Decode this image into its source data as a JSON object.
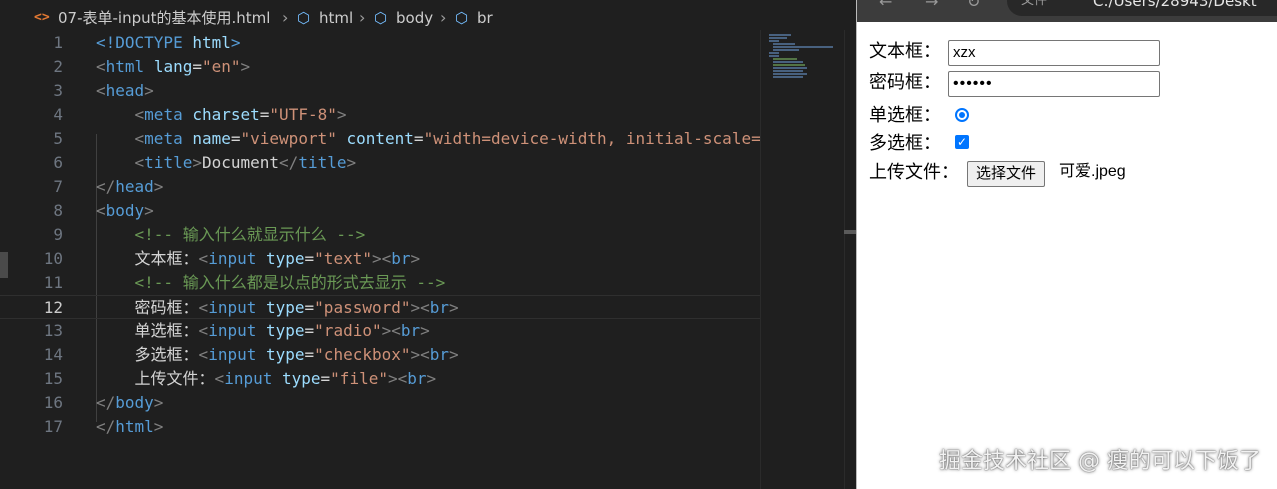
{
  "editor": {
    "breadcrumb": {
      "file": "07-表单-input的基本使用.html",
      "items": [
        "html",
        "body",
        "br"
      ]
    },
    "code_lines": [
      {
        "num": "1",
        "segments": [
          {
            "t": "<!DOCTYPE ",
            "c": "tag"
          },
          {
            "t": "html",
            "c": "attr"
          },
          {
            "t": ">",
            "c": "tag"
          }
        ]
      },
      {
        "num": "2",
        "segments": [
          {
            "t": "<",
            "c": "punct"
          },
          {
            "t": "html",
            "c": "tag"
          },
          {
            "t": " ",
            "c": "txt"
          },
          {
            "t": "lang",
            "c": "attr"
          },
          {
            "t": "=",
            "c": "txt"
          },
          {
            "t": "\"en\"",
            "c": "str"
          },
          {
            "t": ">",
            "c": "punct"
          }
        ]
      },
      {
        "num": "3",
        "segments": [
          {
            "t": "<",
            "c": "punct"
          },
          {
            "t": "head",
            "c": "tag"
          },
          {
            "t": ">",
            "c": "punct"
          }
        ]
      },
      {
        "num": "4",
        "segments": [
          {
            "t": "    ",
            "c": "txt"
          },
          {
            "t": "<",
            "c": "punct"
          },
          {
            "t": "meta",
            "c": "tag"
          },
          {
            "t": " ",
            "c": "txt"
          },
          {
            "t": "charset",
            "c": "attr"
          },
          {
            "t": "=",
            "c": "txt"
          },
          {
            "t": "\"UTF-8\"",
            "c": "str"
          },
          {
            "t": ">",
            "c": "punct"
          }
        ]
      },
      {
        "num": "5",
        "segments": [
          {
            "t": "    ",
            "c": "txt"
          },
          {
            "t": "<",
            "c": "punct"
          },
          {
            "t": "meta",
            "c": "tag"
          },
          {
            "t": " ",
            "c": "txt"
          },
          {
            "t": "name",
            "c": "attr"
          },
          {
            "t": "=",
            "c": "txt"
          },
          {
            "t": "\"viewport\"",
            "c": "str"
          },
          {
            "t": " ",
            "c": "txt"
          },
          {
            "t": "content",
            "c": "attr"
          },
          {
            "t": "=",
            "c": "txt"
          },
          {
            "t": "\"width=device-width, initial-scale=",
            "c": "str"
          }
        ]
      },
      {
        "num": "6",
        "segments": [
          {
            "t": "    ",
            "c": "txt"
          },
          {
            "t": "<",
            "c": "punct"
          },
          {
            "t": "title",
            "c": "tag"
          },
          {
            "t": ">",
            "c": "punct"
          },
          {
            "t": "Document",
            "c": "txt"
          },
          {
            "t": "</",
            "c": "punct"
          },
          {
            "t": "title",
            "c": "tag"
          },
          {
            "t": ">",
            "c": "punct"
          }
        ]
      },
      {
        "num": "7",
        "segments": [
          {
            "t": "</",
            "c": "punct"
          },
          {
            "t": "head",
            "c": "tag"
          },
          {
            "t": ">",
            "c": "punct"
          }
        ]
      },
      {
        "num": "8",
        "segments": [
          {
            "t": "<",
            "c": "punct"
          },
          {
            "t": "body",
            "c": "tag"
          },
          {
            "t": ">",
            "c": "punct"
          }
        ]
      },
      {
        "num": "9",
        "segments": [
          {
            "t": "    ",
            "c": "txt"
          },
          {
            "t": "<!-- 输入什么就显示什么 -->",
            "c": "cmt"
          }
        ]
      },
      {
        "num": "10",
        "segments": [
          {
            "t": "    ",
            "c": "txt"
          },
          {
            "t": "文本框：",
            "c": "txt"
          },
          {
            "t": "<",
            "c": "punct"
          },
          {
            "t": "input",
            "c": "tag"
          },
          {
            "t": " ",
            "c": "txt"
          },
          {
            "t": "type",
            "c": "attr"
          },
          {
            "t": "=",
            "c": "txt"
          },
          {
            "t": "\"text\"",
            "c": "str"
          },
          {
            "t": "><",
            "c": "punct"
          },
          {
            "t": "br",
            "c": "tag"
          },
          {
            "t": ">",
            "c": "punct"
          }
        ]
      },
      {
        "num": "11",
        "segments": [
          {
            "t": "    ",
            "c": "txt"
          },
          {
            "t": "<!-- 输入什么都是以点的形式去显示 -->",
            "c": "cmt"
          }
        ]
      },
      {
        "num": "12",
        "segments": [
          {
            "t": "    ",
            "c": "txt"
          },
          {
            "t": "密码框：",
            "c": "txt"
          },
          {
            "t": "<",
            "c": "punct"
          },
          {
            "t": "input",
            "c": "tag"
          },
          {
            "t": " ",
            "c": "txt"
          },
          {
            "t": "type",
            "c": "attr"
          },
          {
            "t": "=",
            "c": "txt"
          },
          {
            "t": "\"password\"",
            "c": "str"
          },
          {
            "t": "><",
            "c": "punct"
          },
          {
            "t": "br",
            "c": "tag"
          },
          {
            "t": ">",
            "c": "punct"
          }
        ]
      },
      {
        "num": "13",
        "segments": [
          {
            "t": "    ",
            "c": "txt"
          },
          {
            "t": "单选框：",
            "c": "txt"
          },
          {
            "t": "<",
            "c": "punct"
          },
          {
            "t": "input",
            "c": "tag"
          },
          {
            "t": " ",
            "c": "txt"
          },
          {
            "t": "type",
            "c": "attr"
          },
          {
            "t": "=",
            "c": "txt"
          },
          {
            "t": "\"radio\"",
            "c": "str"
          },
          {
            "t": "><",
            "c": "punct"
          },
          {
            "t": "br",
            "c": "tag"
          },
          {
            "t": ">",
            "c": "punct"
          }
        ]
      },
      {
        "num": "14",
        "segments": [
          {
            "t": "    ",
            "c": "txt"
          },
          {
            "t": "多选框：",
            "c": "txt"
          },
          {
            "t": "<",
            "c": "punct"
          },
          {
            "t": "input",
            "c": "tag"
          },
          {
            "t": " ",
            "c": "txt"
          },
          {
            "t": "type",
            "c": "attr"
          },
          {
            "t": "=",
            "c": "txt"
          },
          {
            "t": "\"checkbox\"",
            "c": "str"
          },
          {
            "t": "><",
            "c": "punct"
          },
          {
            "t": "br",
            "c": "tag"
          },
          {
            "t": ">",
            "c": "punct"
          }
        ]
      },
      {
        "num": "15",
        "segments": [
          {
            "t": "    ",
            "c": "txt"
          },
          {
            "t": "上传文件：",
            "c": "txt"
          },
          {
            "t": "<",
            "c": "punct"
          },
          {
            "t": "input",
            "c": "tag"
          },
          {
            "t": " ",
            "c": "txt"
          },
          {
            "t": "type",
            "c": "attr"
          },
          {
            "t": "=",
            "c": "txt"
          },
          {
            "t": "\"file\"",
            "c": "str"
          },
          {
            "t": "><",
            "c": "punct"
          },
          {
            "t": "br",
            "c": "tag"
          },
          {
            "t": ">",
            "c": "punct"
          }
        ]
      },
      {
        "num": "16",
        "segments": [
          {
            "t": "</",
            "c": "punct"
          },
          {
            "t": "body",
            "c": "tag"
          },
          {
            "t": ">",
            "c": "punct"
          }
        ]
      },
      {
        "num": "17",
        "segments": [
          {
            "t": "</",
            "c": "punct"
          },
          {
            "t": "html",
            "c": "tag"
          },
          {
            "t": ">",
            "c": "punct"
          }
        ]
      }
    ],
    "active_line": "12"
  },
  "browser": {
    "address_scheme": "文件",
    "address_url": "C:/Users/28943/Deskt",
    "form": {
      "text_label": "文本框：",
      "text_value": "xzx",
      "password_label": "密码框：",
      "password_value": "••••••",
      "radio_label": "单选框：",
      "radio_checked": true,
      "checkbox_label": "多选框：",
      "checkbox_checked": true,
      "file_label": "上传文件：",
      "file_button": "选择文件",
      "file_name": "可爱.jpeg"
    },
    "watermark": "掘金技术社区 @ 瘦的可以下饭了"
  },
  "colors": {
    "editor_bg": "#1f1f1f",
    "tag": "#569cd6",
    "attr": "#9cdcfe",
    "string": "#ce9178",
    "comment": "#6a9955",
    "accent": "#0075ff"
  }
}
